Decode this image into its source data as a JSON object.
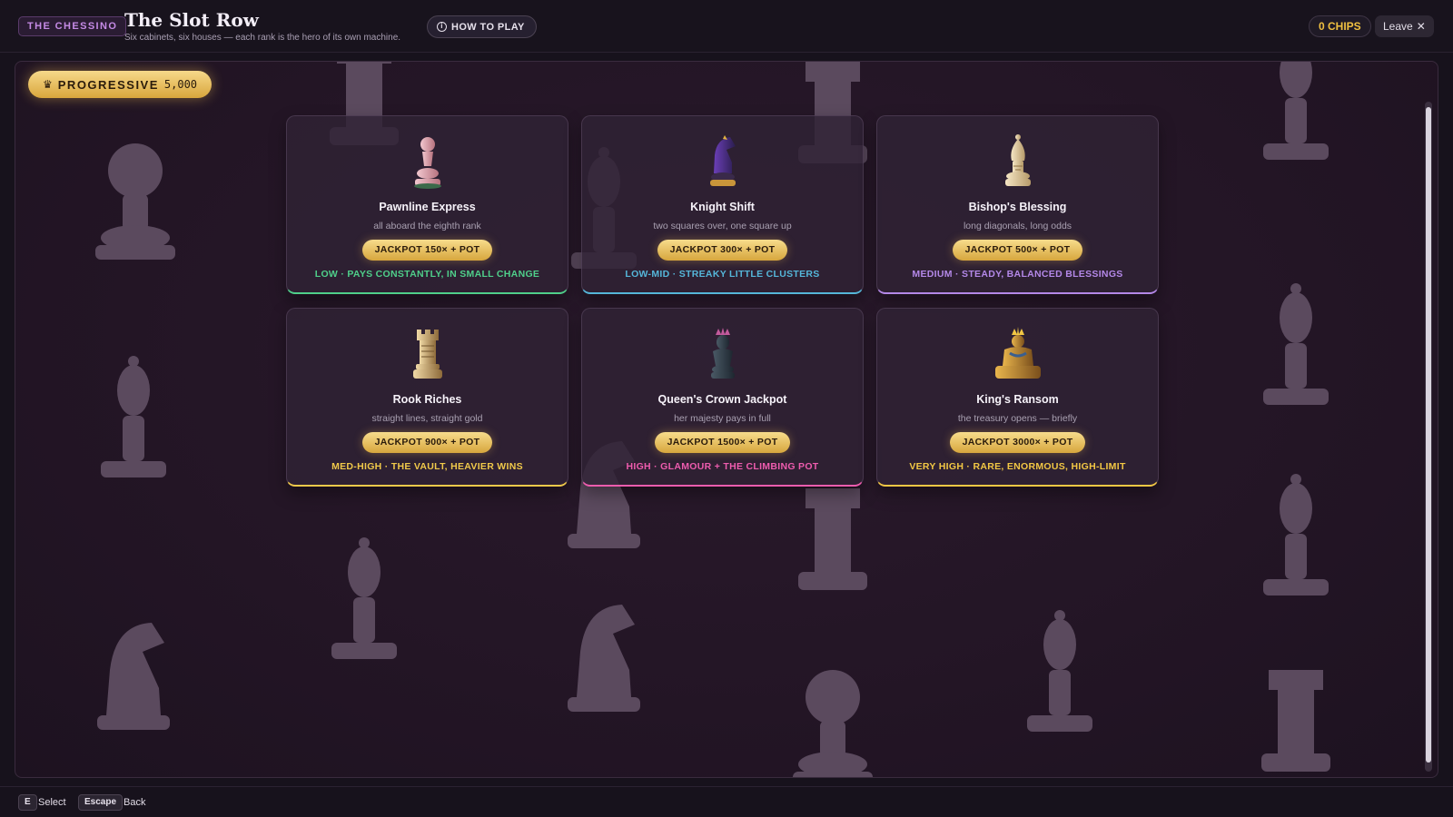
{
  "header": {
    "brand": "THE CHESSINO",
    "title": "The Slot Row",
    "subtitle": "Six cabinets, six houses — each rank is the hero of its own machine.",
    "how_to_play": "HOW TO PLAY",
    "chips": "0 CHIPS",
    "leave": "Leave"
  },
  "progressive": {
    "label": "PROGRESSIVE",
    "value": "5,000"
  },
  "machines": [
    {
      "title": "Pawnline Express",
      "tagline": "all aboard the eighth rank",
      "jackpot": "JACKPOT 150× + POT",
      "volatility": "LOW · PAYS CONSTANTLY, IN SMALL CHANGE",
      "accent": "#4fcf8a",
      "icon": "pawn-icon"
    },
    {
      "title": "Knight Shift",
      "tagline": "two squares over, one square up",
      "jackpot": "JACKPOT 300× + POT",
      "volatility": "LOW-MID · STREAKY LITTLE CLUSTERS",
      "accent": "#55b6d9",
      "icon": "knight-icon"
    },
    {
      "title": "Bishop's Blessing",
      "tagline": "long diagonals, long odds",
      "jackpot": "JACKPOT 500× + POT",
      "volatility": "MEDIUM · STEADY, BALANCED BLESSINGS",
      "accent": "#b488e8",
      "icon": "bishop-icon"
    },
    {
      "title": "Rook Riches",
      "tagline": "straight lines, straight gold",
      "jackpot": "JACKPOT 900× + POT",
      "volatility": "MED-HIGH · THE VAULT, HEAVIER WINS",
      "accent": "#f0c94a",
      "icon": "rook-icon"
    },
    {
      "title": "Queen's Crown Jackpot",
      "tagline": "her majesty pays in full",
      "jackpot": "JACKPOT 1500× + POT",
      "volatility": "HIGH · GLAMOUR + THE CLIMBING POT",
      "accent": "#ee5cae",
      "icon": "queen-icon"
    },
    {
      "title": "King's Ransom",
      "tagline": "the treasury opens — briefly",
      "jackpot": "JACKPOT 3000× + POT",
      "volatility": "VERY HIGH · RARE, ENORMOUS, HIGH-LIMIT",
      "accent": "#f2c744",
      "icon": "king-icon"
    }
  ],
  "footer": {
    "select_key": "E",
    "select_label": "Select",
    "back_key": "Escape",
    "back_label": "Back"
  }
}
